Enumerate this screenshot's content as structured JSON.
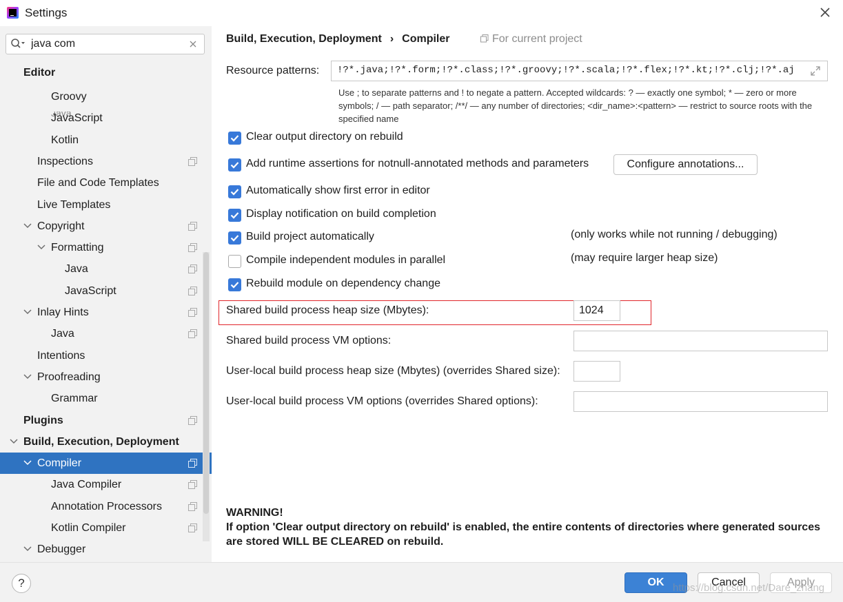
{
  "window": {
    "title": "Settings"
  },
  "search": {
    "value": "java com"
  },
  "sidebar": {
    "section_editor": "Editor",
    "cut_item": "Java",
    "items": [
      {
        "label": "Groovy",
        "indent": 2,
        "arrow": "none",
        "proj": false,
        "bold": false,
        "selected": false
      },
      {
        "label": "JavaScript",
        "indent": 2,
        "arrow": "none",
        "proj": false,
        "bold": false,
        "selected": false
      },
      {
        "label": "Kotlin",
        "indent": 2,
        "arrow": "none",
        "proj": false,
        "bold": false,
        "selected": false
      },
      {
        "label": "Inspections",
        "indent": 1,
        "arrow": "none",
        "proj": true,
        "bold": false,
        "selected": false
      },
      {
        "label": "File and Code Templates",
        "indent": 1,
        "arrow": "none",
        "proj": false,
        "bold": false,
        "selected": false
      },
      {
        "label": "Live Templates",
        "indent": 1,
        "arrow": "none",
        "proj": false,
        "bold": false,
        "selected": false
      },
      {
        "label": "Copyright",
        "indent": 1,
        "arrow": "down",
        "proj": true,
        "bold": false,
        "selected": false
      },
      {
        "label": "Formatting",
        "indent": 2,
        "arrow": "down",
        "proj": true,
        "bold": false,
        "selected": false
      },
      {
        "label": "Java",
        "indent": 3,
        "arrow": "none",
        "proj": true,
        "bold": false,
        "selected": false
      },
      {
        "label": "JavaScript",
        "indent": 3,
        "arrow": "none",
        "proj": true,
        "bold": false,
        "selected": false
      },
      {
        "label": "Inlay Hints",
        "indent": 1,
        "arrow": "down",
        "proj": true,
        "bold": false,
        "selected": false
      },
      {
        "label": "Java",
        "indent": 2,
        "arrow": "none",
        "proj": true,
        "bold": false,
        "selected": false
      },
      {
        "label": "Intentions",
        "indent": 1,
        "arrow": "none",
        "proj": false,
        "bold": false,
        "selected": false
      },
      {
        "label": "Proofreading",
        "indent": 1,
        "arrow": "down",
        "proj": false,
        "bold": false,
        "selected": false
      },
      {
        "label": "Grammar",
        "indent": 2,
        "arrow": "none",
        "proj": false,
        "bold": false,
        "selected": false
      },
      {
        "label": "Plugins",
        "indent": 0,
        "arrow": "none",
        "proj": true,
        "bold": true,
        "selected": false
      },
      {
        "label": "Build, Execution, Deployment",
        "indent": 0,
        "arrow": "down",
        "proj": false,
        "bold": true,
        "selected": false
      },
      {
        "label": "Compiler",
        "indent": 1,
        "arrow": "down",
        "proj": true,
        "bold": false,
        "selected": true
      },
      {
        "label": "Java Compiler",
        "indent": 2,
        "arrow": "none",
        "proj": true,
        "bold": false,
        "selected": false
      },
      {
        "label": "Annotation Processors",
        "indent": 2,
        "arrow": "none",
        "proj": true,
        "bold": false,
        "selected": false
      },
      {
        "label": "Kotlin Compiler",
        "indent": 2,
        "arrow": "none",
        "proj": true,
        "bold": false,
        "selected": false
      },
      {
        "label": "Debugger",
        "indent": 1,
        "arrow": "down",
        "proj": false,
        "bold": false,
        "selected": false
      }
    ]
  },
  "breadcrumb": {
    "parent": "Build, Execution, Deployment",
    "separator": "›",
    "current": "Compiler",
    "scope": "For current project"
  },
  "resource": {
    "label": "Resource patterns:",
    "value": "!?*.java;!?*.form;!?*.class;!?*.groovy;!?*.scala;!?*.flex;!?*.kt;!?*.clj;!?*.aj",
    "hint": "Use ; to separate patterns and ! to negate a pattern. Accepted wildcards: ? — exactly one symbol; * — zero or more symbols; / — path separator; /**/ — any number of directories; <dir_name>:<pattern> — restrict to source roots with the specified name"
  },
  "options": [
    {
      "label": "Clear output directory on rebuild",
      "checked": true,
      "note": ""
    },
    {
      "label": "Add runtime assertions for notnull-annotated methods and parameters",
      "checked": true,
      "note": ""
    },
    {
      "label": "Automatically show first error in editor",
      "checked": true,
      "note": ""
    },
    {
      "label": "Display notification on build completion",
      "checked": true,
      "note": ""
    },
    {
      "label": "Build project automatically",
      "checked": true,
      "note": "(only works while not running / debugging)"
    },
    {
      "label": "Compile independent modules in parallel",
      "checked": false,
      "note": "(may require larger heap size)"
    },
    {
      "label": "Rebuild module on dependency change",
      "checked": true,
      "note": ""
    }
  ],
  "configure_button": "Configure annotations...",
  "fields": {
    "shared_heap": {
      "label": "Shared build process heap size (Mbytes):",
      "value": "1024"
    },
    "shared_vm": {
      "label": "Shared build process VM options:",
      "value": ""
    },
    "user_heap": {
      "label": "User-local build process heap size (Mbytes) (overrides Shared size):",
      "value": ""
    },
    "user_vm": {
      "label": "User-local build process VM options (overrides Shared options):",
      "value": ""
    }
  },
  "warning": {
    "title": "WARNING!",
    "text": "If option 'Clear output directory on rebuild' is enabled, the entire contents of directories where generated sources are stored WILL BE CLEARED on rebuild."
  },
  "footer": {
    "help": "?",
    "ok": "OK",
    "cancel": "Cancel",
    "apply": "Apply"
  },
  "watermark": "https://blog.csdn.net/Dare_zhang",
  "colors": {
    "accent": "#3879d9",
    "selection": "#2f73c1",
    "highlight_border": "#e0242a",
    "sidebar_bg": "#f2f2f2"
  }
}
